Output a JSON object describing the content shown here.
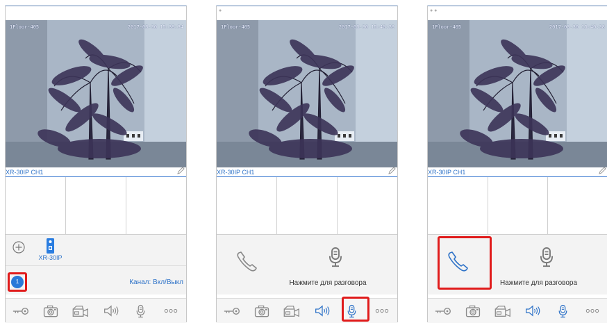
{
  "screens": [
    {
      "osd_left": "1Floor-405",
      "osd_right": "2017-03-30 15:39:34",
      "channel": "XR-30IP CH1",
      "mode": "devices"
    },
    {
      "osd_left": "1Floor-405",
      "osd_right": "2017-03-30 15:40:29",
      "channel": "XR-30IP CH1",
      "mode": "talk"
    },
    {
      "osd_left": "1Floor-405",
      "osd_right": "2017-03-30 15:40:38",
      "channel": "XR-30IP CH1",
      "mode": "talk"
    }
  ],
  "device": {
    "label": "XR-30IP"
  },
  "list": {
    "badge": "1",
    "channel_toggle": "Канал: Вкл/Выкл"
  },
  "talk": {
    "hint": "Нажмите для разговора"
  },
  "toolbar_icons": [
    "key-icon",
    "camera-icon",
    "video-record-icon",
    "speaker-icon",
    "microphone-icon",
    "more-icon"
  ],
  "colors": {
    "accent": "#2f73c8",
    "highlight": "#e01b1b",
    "active_icon": "#2f73c8",
    "inactive_icon": "#8a8a8a"
  }
}
